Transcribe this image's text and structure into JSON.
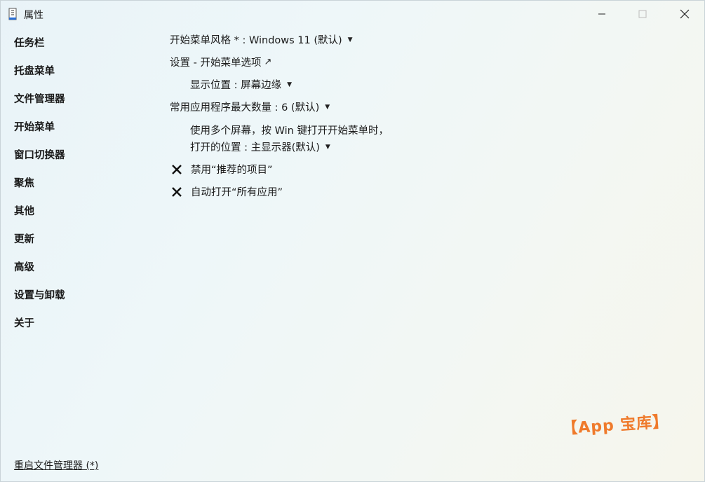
{
  "window": {
    "title": "属性",
    "icon": "document-icon"
  },
  "sidebar": {
    "items": [
      {
        "label": "任务栏"
      },
      {
        "label": "托盘菜单"
      },
      {
        "label": "文件管理器"
      },
      {
        "label": "开始菜单"
      },
      {
        "label": "窗口切换器"
      },
      {
        "label": "聚焦"
      },
      {
        "label": "其他"
      },
      {
        "label": "更新"
      },
      {
        "label": "高级"
      },
      {
        "label": "设置与卸载"
      },
      {
        "label": "关于"
      }
    ],
    "restart_link": "重启文件管理器 (*)"
  },
  "main": {
    "start_menu_style": "开始菜单风格 * : Windows 11 (默认)",
    "settings_link": "设置 - 开始菜单选项",
    "display_position": "显示位置 : 屏幕边缘",
    "max_frequent_apps": "常用应用程序最大数量 : 6 (默认)",
    "multi_monitor_line1": "使用多个屏幕，按 Win 键打开开始菜单时，",
    "multi_monitor_line2": "打开的位置 : 主显示器(默认)",
    "disable_recommended": "禁用“推荐的项目”",
    "auto_open_all_apps": "自动打开“所有应用”"
  },
  "watermark": "【App 宝库】",
  "colors": {
    "watermark": "#ef7a2b"
  }
}
